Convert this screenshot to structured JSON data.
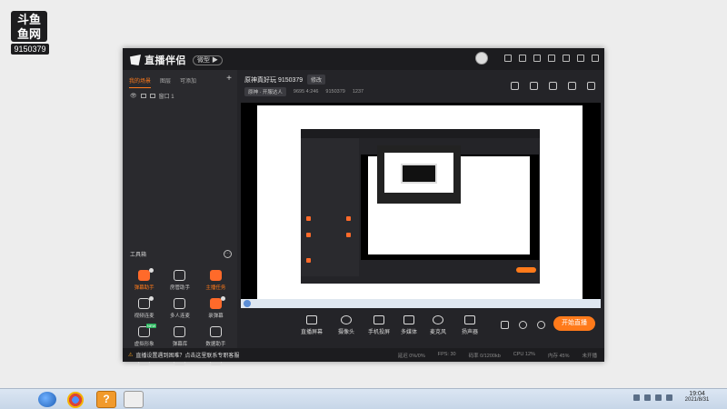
{
  "watermark": {
    "logo_text": "斗鱼\n鱼网",
    "room_no": "9150379"
  },
  "app": {
    "brand": "直播伴侣",
    "version_badge": "微型 ▶",
    "sidebar_tabs": [
      "我的场景",
      "图层",
      "可添加"
    ],
    "scene_label": "窗口 1",
    "tools_title": "工具箱",
    "tools": [
      {
        "label": "弹幕助手",
        "accent": true
      },
      {
        "label": "房管助手",
        "accent": false
      },
      {
        "label": "主播任务",
        "accent": true
      },
      {
        "label": "视频连麦",
        "accent": false
      },
      {
        "label": "多人连麦",
        "accent": false
      },
      {
        "label": "录弹幕",
        "accent": true
      },
      {
        "label": "虚拟形象",
        "accent": false
      },
      {
        "label": "弹幕库",
        "accent": false
      },
      {
        "label": "数据助手",
        "accent": false
      },
      {
        "label": "",
        "accent": true
      },
      {
        "label": "",
        "accent": false
      },
      {
        "label": "",
        "accent": false
      }
    ],
    "status_text": "直播设置遇到困难？点击这里联系专职客服",
    "metrics": [
      "延迟 0%/0%",
      "FPS: 30",
      "码率 0/1200kb",
      "CPU 12%",
      "内存 45%",
      "未开播"
    ],
    "room_title": "原神真好玩 9150379",
    "edit_label": "修改",
    "category": "原神 · 开服达人",
    "meta": [
      "9695 4:246",
      "9150379",
      "1237"
    ],
    "controls": [
      {
        "label": "直播屏幕"
      },
      {
        "label": "摄像头"
      },
      {
        "label": "手机投屏"
      },
      {
        "label": "多媒体"
      },
      {
        "label": "麦克风"
      },
      {
        "label": "扬声器"
      }
    ],
    "go_live": "开始直播"
  },
  "taskbar": {
    "time": "19:04",
    "date": "2021/8/31"
  },
  "colors": {
    "accent": "#ff7a1a",
    "app_bg": "#242428",
    "titlebar": "#1c1c1f"
  }
}
